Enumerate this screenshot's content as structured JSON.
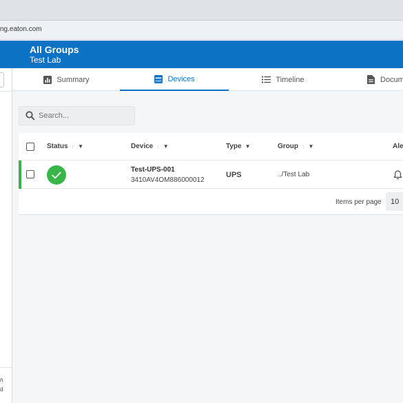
{
  "browser": {
    "url": "ng.eaton.com"
  },
  "header": {
    "title": "All Groups",
    "subtitle": "Test Lab"
  },
  "drawer": {
    "footer_lines": [
      "n",
      "d"
    ]
  },
  "tabs": [
    {
      "label": "Summary",
      "icon": "bar-chart-icon",
      "active": false
    },
    {
      "label": "Devices",
      "icon": "device-icon",
      "active": true
    },
    {
      "label": "Timeline",
      "icon": "list-icon",
      "active": false
    },
    {
      "label": "Docum",
      "icon": "document-icon",
      "active": false
    }
  ],
  "search": {
    "placeholder": "Search..."
  },
  "table": {
    "columns": {
      "status": "Status",
      "device": "Device",
      "type": "Type",
      "group": "Group",
      "alerts": "Ale"
    },
    "rows": [
      {
        "status": "ok",
        "device_name": "Test-UPS-001",
        "device_serial": "3410AV4OM886000012",
        "type": "UPS",
        "group": "../Test Lab",
        "alert_icon": "bell-icon"
      }
    ],
    "pagination": {
      "items_per_page_label": "Items per page",
      "items_per_page_value": "10"
    }
  },
  "colors": {
    "brand_blue": "#0c73c4",
    "status_green": "#39b54a"
  }
}
